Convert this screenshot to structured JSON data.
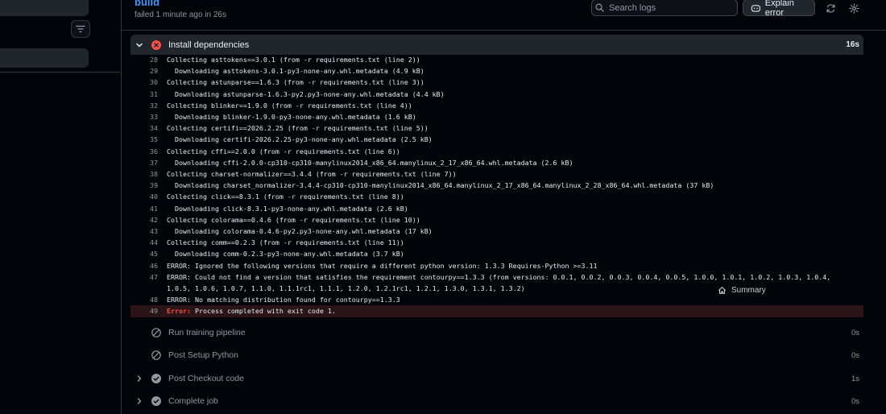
{
  "header": {
    "title": "build",
    "subtitle": "failed 1 minute ago in 26s",
    "search_placeholder": "Search logs",
    "explain_label": "Explain error"
  },
  "current_step": {
    "name": "Install dependencies",
    "duration": "16s"
  },
  "log": [
    {
      "n": "28",
      "t": "Collecting asttokens==3.0.1 (from -r requirements.txt (line 2))"
    },
    {
      "n": "29",
      "t": "  Downloading asttokens-3.0.1-py3-none-any.whl.metadata (4.9 kB)"
    },
    {
      "n": "30",
      "t": "Collecting astunparse==1.6.3 (from -r requirements.txt (line 3))"
    },
    {
      "n": "31",
      "t": "  Downloading astunparse-1.6.3-py2.py3-none-any.whl.metadata (4.4 kB)"
    },
    {
      "n": "32",
      "t": "Collecting blinker==1.9.0 (from -r requirements.txt (line 4))"
    },
    {
      "n": "33",
      "t": "  Downloading blinker-1.9.0-py3-none-any.whl.metadata (1.6 kB)"
    },
    {
      "n": "34",
      "t": "Collecting certifi==2026.2.25 (from -r requirements.txt (line 5))"
    },
    {
      "n": "35",
      "t": "  Downloading certifi-2026.2.25-py3-none-any.whl.metadata (2.5 kB)"
    },
    {
      "n": "36",
      "t": "Collecting cffi==2.0.0 (from -r requirements.txt (line 6))"
    },
    {
      "n": "37",
      "t": "  Downloading cffi-2.0.0-cp310-cp310-manylinux2014_x86_64.manylinux_2_17_x86_64.whl.metadata (2.6 kB)"
    },
    {
      "n": "38",
      "t": "Collecting charset-normalizer==3.4.4 (from -r requirements.txt (line 7))"
    },
    {
      "n": "39",
      "t": "  Downloading charset_normalizer-3.4.4-cp310-cp310-manylinux2014_x86_64.manylinux_2_17_x86_64.manylinux_2_28_x86_64.whl.metadata (37 kB)"
    },
    {
      "n": "40",
      "t": "Collecting click==8.3.1 (from -r requirements.txt (line 8))"
    },
    {
      "n": "41",
      "t": "  Downloading click-8.3.1-py3-none-any.whl.metadata (2.6 kB)"
    },
    {
      "n": "42",
      "t": "Collecting colorama==0.4.6 (from -r requirements.txt (line 10))"
    },
    {
      "n": "43",
      "t": "  Downloading colorama-0.4.6-py2.py3-none-any.whl.metadata (17 kB)"
    },
    {
      "n": "44",
      "t": "Collecting comm==0.2.3 (from -r requirements.txt (line 11))"
    },
    {
      "n": "45",
      "t": "  Downloading comm-0.2.3-py3-none-any.whl.metadata (3.7 kB)"
    },
    {
      "n": "46",
      "t": "ERROR: Ignored the following versions that require a different python version: 1.3.3 Requires-Python >=3.11"
    },
    {
      "n": "47",
      "t": "ERROR: Could not find a version that satisfies the requirement contourpy==1.3.3 (from versions: 0.0.1, 0.0.2, 0.0.3, 0.0.4, 0.0.5, 1.0.0, 1.0.1, 1.0.2, 1.0.3, 1.0.4, 1.0.5, 1.0.6, 1.0.7, 1.1.0, 1.1.1rc1, 1.1.1, 1.2.0, 1.2.1rc1, 1.2.1, 1.3.0, 1.3.1, 1.3.2)"
    },
    {
      "n": "48",
      "t": "ERROR: No matching distribution found for contourpy==1.3.3"
    }
  ],
  "error_line": {
    "n": "49",
    "prefix": "Error:",
    "t": " Process completed with exit code 1."
  },
  "summary_label": "Summary",
  "steps": [
    {
      "name": "Run training pipeline",
      "duration": "0s",
      "status": "skipped",
      "expandable": false
    },
    {
      "name": "Post Setup Python",
      "duration": "0s",
      "status": "skipped",
      "expandable": false
    },
    {
      "name": "Post Checkout code",
      "duration": "1s",
      "status": "success",
      "expandable": true
    },
    {
      "name": "Complete job",
      "duration": "0s",
      "status": "success",
      "expandable": true
    }
  ],
  "colors": {
    "error": "#f85149",
    "link": "#4493f8",
    "muted": "#9198a1"
  }
}
